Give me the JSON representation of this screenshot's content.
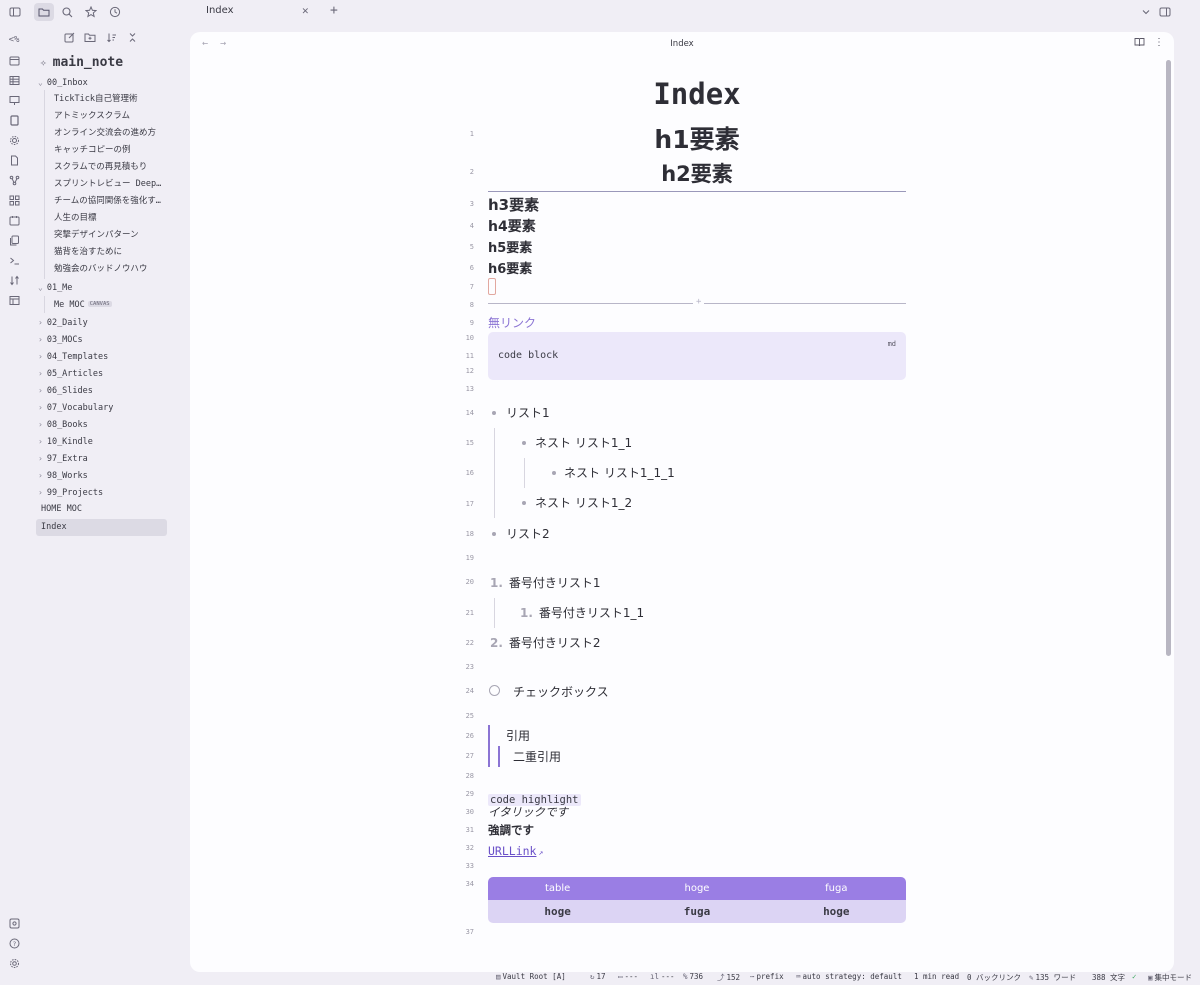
{
  "window": {
    "tab_title": "Index",
    "tab_close": "✕",
    "tab_new": "+",
    "top_icons": {
      "sidebar_toggle": "sidebar-toggle-icon",
      "files": "folder-icon",
      "search": "search-icon",
      "bookmarks": "star-icon",
      "recent": "clock-icon"
    }
  },
  "ribbon": {
    "items": [
      "<%",
      "calendar-icon",
      "table-icon",
      "presentation-icon",
      "note-icon",
      "gear-icon",
      "file-icon",
      "graph-icon",
      "grid-icon",
      "calendar-icon",
      "copy-icon",
      "terminal-icon",
      "swap-icon",
      "layout-icon"
    ],
    "first_label": "<%",
    "bottom": [
      "vault-icon",
      "help-icon",
      "settings-icon"
    ]
  },
  "sidebar": {
    "vault_name": "main_note",
    "items": [
      {
        "label": "00_Inbox",
        "type": "folder",
        "open": true
      },
      {
        "label": "TickTick自己管理術"
      },
      {
        "label": "アトミックスクラム"
      },
      {
        "label": "オンライン交流会の進め方"
      },
      {
        "label": "キャッチコピーの例"
      },
      {
        "label": "スクラムでの再見積もり"
      },
      {
        "label": "スプリントレビュー Deep…"
      },
      {
        "label": "チームの協同関係を強化す…"
      },
      {
        "label": "人生の目標"
      },
      {
        "label": "突撃デザインパターン"
      },
      {
        "label": "猫背を治すために"
      },
      {
        "label": "勉強会のバッドノウハウ"
      },
      {
        "label": "01_Me",
        "type": "folder",
        "open": true
      },
      {
        "label": "Me MOC",
        "badge": "CANVAS"
      },
      {
        "label": "02_Daily",
        "type": "folder"
      },
      {
        "label": "03_MOCs",
        "type": "folder"
      },
      {
        "label": "04_Templates",
        "type": "folder"
      },
      {
        "label": "05_Articles",
        "type": "folder"
      },
      {
        "label": "06_Slides",
        "type": "folder"
      },
      {
        "label": "07_Vocabulary",
        "type": "folder"
      },
      {
        "label": "08_Books",
        "type": "folder"
      },
      {
        "label": "10_Kindle",
        "type": "folder"
      },
      {
        "label": "97_Extra",
        "type": "folder"
      },
      {
        "label": "98_Works",
        "type": "folder"
      },
      {
        "label": "99_Projects",
        "type": "folder"
      },
      {
        "label": "HOME MOC"
      },
      {
        "label": "Index",
        "selected": true
      }
    ]
  },
  "pane": {
    "title": "Index",
    "back": "←",
    "forward": "→"
  },
  "doc": {
    "title": "Index",
    "line_numbers": [
      "1",
      "2",
      "3",
      "4",
      "5",
      "6",
      "7",
      "8",
      "9",
      "10",
      "11",
      "12",
      "13",
      "14",
      "15",
      "16",
      "17",
      "18",
      "19",
      "20",
      "21",
      "22",
      "23",
      "24",
      "25",
      "26",
      "27",
      "28",
      "29",
      "30",
      "31",
      "32",
      "33",
      "34",
      "37"
    ],
    "h1": "h1要素",
    "h2": "h2要素",
    "h3": "h3要素",
    "h4": "h4要素",
    "h5": "h5要素",
    "h6": "h6要素",
    "hr_mark": "+",
    "no_link": "無リンク",
    "code_lang": "md",
    "code_text": "code block",
    "list1": "リスト1",
    "nest1_1": "ネスト リスト1_1",
    "nest1_1_1": "ネスト リスト1_1_1",
    "nest1_2": "ネスト リスト1_2",
    "list2": "リスト2",
    "ol1_num": "1.",
    "ol1": "番号付きリスト1",
    "ol1_1_num": "1.",
    "ol1_1": "番号付きリスト1_1",
    "ol2_num": "2.",
    "ol2": "番号付きリスト2",
    "checkbox": "チェックボックス",
    "quote": "引用",
    "quote2": "二重引用",
    "inline_code": "code highlight",
    "italic": "イタリックです",
    "bold": "強調です",
    "url_link": "URLLink",
    "table": {
      "headers": [
        "table",
        "hoge",
        "fuga"
      ],
      "rows": [
        [
          "hoge",
          "fuga",
          "hoge"
        ]
      ]
    }
  },
  "status": {
    "vault": "Vault Root [A]",
    "s1": "17",
    "s2": "---",
    "s3": "---",
    "s4": "736",
    "s5": "152",
    "prefix": "prefix",
    "auto": "auto strategy: default",
    "read": "1 min read",
    "backlinks": "0 バックリンク",
    "words": "135 ワード",
    "chars": "388 文字",
    "focus": "集中モード"
  }
}
